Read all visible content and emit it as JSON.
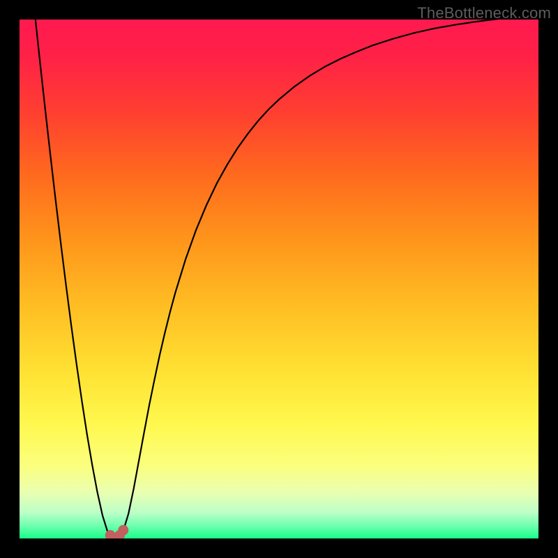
{
  "watermark": "TheBottleneck.com",
  "gradient_stops": [
    {
      "offset": 0.0,
      "color": "#ff1a4f"
    },
    {
      "offset": 0.07,
      "color": "#ff2147"
    },
    {
      "offset": 0.18,
      "color": "#ff3f30"
    },
    {
      "offset": 0.3,
      "color": "#ff6a1e"
    },
    {
      "offset": 0.42,
      "color": "#ff931b"
    },
    {
      "offset": 0.55,
      "color": "#ffbd23"
    },
    {
      "offset": 0.68,
      "color": "#ffe233"
    },
    {
      "offset": 0.78,
      "color": "#fff84e"
    },
    {
      "offset": 0.86,
      "color": "#fbff7e"
    },
    {
      "offset": 0.91,
      "color": "#eaffb0"
    },
    {
      "offset": 0.95,
      "color": "#bcffc7"
    },
    {
      "offset": 0.975,
      "color": "#70ffb0"
    },
    {
      "offset": 1.0,
      "color": "#18ff87"
    }
  ],
  "marker_color": "#c1605f",
  "curve_color": "#000000",
  "chart_data": {
    "type": "line",
    "title": "",
    "xlabel": "",
    "ylabel": "",
    "xlim": [
      0,
      100
    ],
    "ylim": [
      0,
      100
    ],
    "x": [
      0,
      1,
      2,
      3,
      4,
      5,
      6,
      7,
      8,
      9,
      10,
      11,
      12,
      13,
      14,
      15,
      16,
      17,
      18,
      19,
      20,
      21,
      22,
      23,
      24,
      25,
      26,
      27,
      28,
      29,
      30,
      32,
      34,
      36,
      38,
      40,
      42,
      44,
      46,
      48,
      50,
      53,
      56,
      59,
      62,
      65,
      68,
      72,
      76,
      80,
      84,
      88,
      92,
      96,
      100
    ],
    "y": [
      130,
      120.0,
      110.2,
      100.6,
      91.3,
      82.2,
      73.4,
      64.8,
      56.5,
      48.5,
      40.8,
      33.5,
      26.6,
      20.1,
      14.2,
      8.9,
      4.4,
      1.2,
      0.2,
      0.2,
      1.5,
      4.8,
      9.6,
      15.0,
      20.4,
      25.7,
      30.6,
      35.3,
      39.6,
      43.6,
      47.3,
      53.8,
      59.4,
      64.2,
      68.4,
      72.0,
      75.2,
      78.0,
      80.5,
      82.7,
      84.6,
      87.1,
      89.2,
      91.0,
      92.5,
      93.8,
      95.0,
      96.3,
      97.4,
      98.3,
      99.0,
      99.6,
      100.1,
      100.5,
      100.9
    ],
    "markers": [
      {
        "x": 17.5,
        "y": 0.6
      },
      {
        "x": 18.0,
        "y": 0.1
      },
      {
        "x": 18.6,
        "y": 0.1
      },
      {
        "x": 19.3,
        "y": 0.6
      },
      {
        "x": 20.0,
        "y": 1.6
      }
    ]
  }
}
